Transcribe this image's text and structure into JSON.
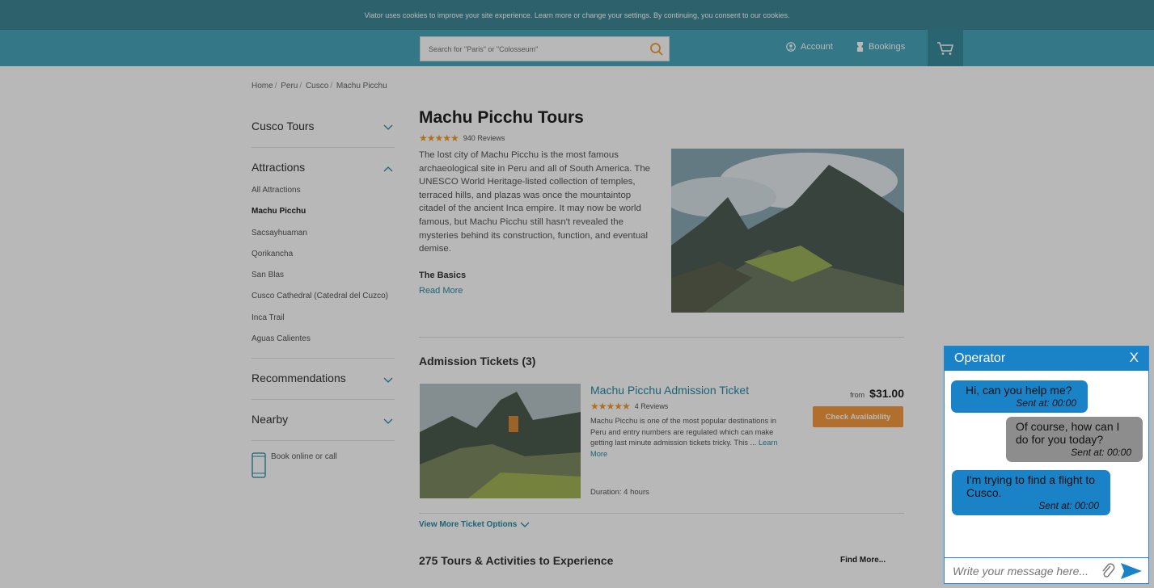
{
  "cookie_bar": {
    "text": "Viator uses cookies to improve your site experience. Learn more or change your settings. By continuing, you consent to our cookies."
  },
  "header": {
    "search_placeholder": "Search for \"Paris\" or \"Colosseum\"",
    "account_label": "Account",
    "bookings_label": "Bookings"
  },
  "breadcrumb": [
    "Home",
    "Peru",
    "Cusco",
    "Machu Picchu"
  ],
  "sidebar": {
    "cusco_tours": "Cusco Tours",
    "attractions": "Attractions",
    "attraction_items": [
      "All Attractions",
      "Machu Picchu",
      "Sacsayhuaman",
      "Qorikancha",
      "San Blas",
      "Cusco Cathedral (Catedral del Cuzco)",
      "Inca Trail",
      "Aguas Calientes"
    ],
    "recommendations": "Recommendations",
    "nearby": "Nearby",
    "book_call": "Book online or call"
  },
  "main": {
    "title": "Machu Picchu Tours",
    "stars": "★★★★★",
    "reviews": "940 Reviews",
    "description": "The lost city of Machu Picchu is the most famous archaeological site in Peru and all of South America. The UNESCO World Heritage-listed collection of temples, terraced hills, and plazas was once the mountaintop citadel of the ancient Inca empire. It may now be world famous, but Machu Picchu still hasn't revealed the mysteries behind its construction, function, and eventual demise.",
    "basics_heading": "The Basics",
    "read_more": "Read More",
    "admission_heading": "Admission Tickets (3)",
    "ticket": {
      "title": "Machu Picchu Admission Ticket",
      "stars": "★★★★★",
      "reviews": "4 Reviews",
      "description": "Machu Picchu is one of the most popular destinations in Peru and entry numbers are regulated which can make getting last minute admission tickets tricky. This ...",
      "learn_more": "Learn More",
      "duration": "Duration: 4 hours",
      "from_label": "from",
      "price": "$31.00",
      "check_button": "Check Availability"
    },
    "view_more": "View More Ticket Options",
    "tours_heading": "275 Tours & Activities to Experience",
    "find_more": "Find More..."
  },
  "chat": {
    "title": "Operator",
    "close": "X",
    "messages": [
      {
        "text": "Hi, can you help me?",
        "time": "Sent at: 00:00"
      },
      {
        "text": "Of course, how can I do for you today?",
        "time": "Sent at: 00:00"
      },
      {
        "text": "I'm trying to find a flight to Cusco.",
        "time": "Sent at: 00:00"
      }
    ],
    "input_placeholder": "Write your message here..."
  },
  "colors": {
    "teal": "#49a7bc",
    "chat_blue": "#1a82c7",
    "button_orange": "#f49a3d",
    "operator_bubble": "#8d8d8d"
  }
}
